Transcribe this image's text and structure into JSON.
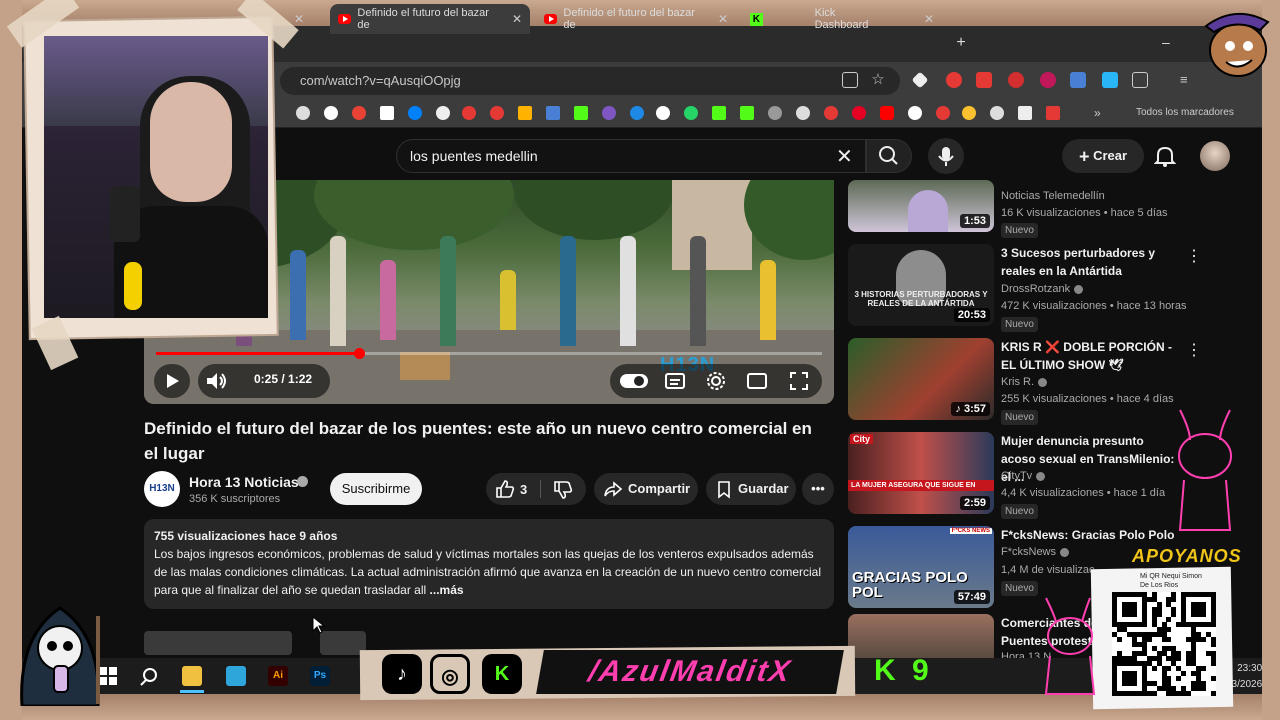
{
  "browser": {
    "tabs": [
      {
        "label": "Definido el futuro del bazar de"
      },
      {
        "label": "Definido el futuro del bazar de"
      },
      {
        "label": "Kick Dashboard"
      }
    ],
    "new_tab": "+",
    "minimize": "–",
    "url": "com/watch?v=qAusqiOOpjg",
    "all_bookmarks": "Todos los marcadores"
  },
  "youtube": {
    "search_query": "los puentes medellin",
    "create_label": "Crear",
    "player": {
      "current_time": "0:25",
      "duration": "1:22",
      "time_display": "0:25 / 1:22",
      "progress_fraction": 0.305,
      "watermark": "H13N"
    },
    "video": {
      "title": "Definido el futuro del bazar de los puentes: este año un nuevo centro comercial en el lugar",
      "channel": "Hora 13 Noticias",
      "channel_avatar_text": "H13N",
      "subscribers": "356 K suscriptores",
      "subscribe_label": "Suscribirme",
      "likes": "3",
      "share_label": "Compartir",
      "save_label": "Guardar",
      "description_meta": "755 visualizaciones  hace 9 años",
      "description": "Los bajos ingresos económicos, problemas de salud y víctimas mortales son las quejas de los venteros expulsados además de las malas condiciones climáticas. La actual administración afirmó que  avanza en la creación de un nuevo centro comercial para que al finalizar del año se quedan trasladar all",
      "more_label": "...más"
    },
    "recommendations": [
      {
        "title": "",
        "channel": "Noticias Telemedellín",
        "meta": "16 K visualizaciones • hace 5 días",
        "badge": "Nuevo",
        "duration": "1:53"
      },
      {
        "title": "3 Sucesos perturbadores y reales en la Antártida",
        "channel": "DrossRotzank",
        "meta": "472 K visualizaciones • hace 13 horas",
        "badge": "Nuevo",
        "duration": "20:53",
        "thumb_text": "3 HISTORIAS PERTURBADORAS Y REALES DE LA ANTÁRTIDA"
      },
      {
        "title": "KRIS R ❌ DOBLE PORCIÓN - EL ÚLTIMO SHOW 🕊",
        "channel": "Kris R.",
        "meta": "255 K visualizaciones • hace 4 días",
        "badge": "Nuevo",
        "duration": "3:57"
      },
      {
        "title": "Mujer denuncia presunto acoso sexual en TransMilenio: el ...",
        "channel": "CityTv",
        "meta": "4,4 K visualizaciones • hace 1 día",
        "badge": "Nuevo",
        "duration": "2:59",
        "thumb_text": "LA MUJER ASEGURA QUE SIGUE EN",
        "thumb_logo": "City"
      },
      {
        "title": "F*cksNews: Gracias Polo Polo",
        "channel": "F*cksNews",
        "meta": "1,4 M de visualizac",
        "badge": "Nuevo",
        "duration": "57:49",
        "thumb_text": "GRACIAS POLO POL",
        "thumb_logo": "F*CKS NEWS"
      },
      {
        "title": "Comerciantes de Puentes protest",
        "channel": "Hora 13 N",
        "meta": "",
        "badge": "",
        "duration": ""
      }
    ]
  },
  "taskbar": {
    "clock_time": "23:30",
    "clock_date": "03/2026",
    "apps": [
      "Ai",
      "Ps"
    ]
  },
  "overlay": {
    "handle": "/AzulMalditX",
    "kick_letter": "K",
    "k9": "K 9",
    "support": "APOYANOS",
    "qr_label": "Mi QR Nequi Simon De Los Rios"
  },
  "colors": {
    "yt_red": "#ff0000",
    "kick_green": "#53fc18",
    "pink": "#ff3fb0"
  }
}
